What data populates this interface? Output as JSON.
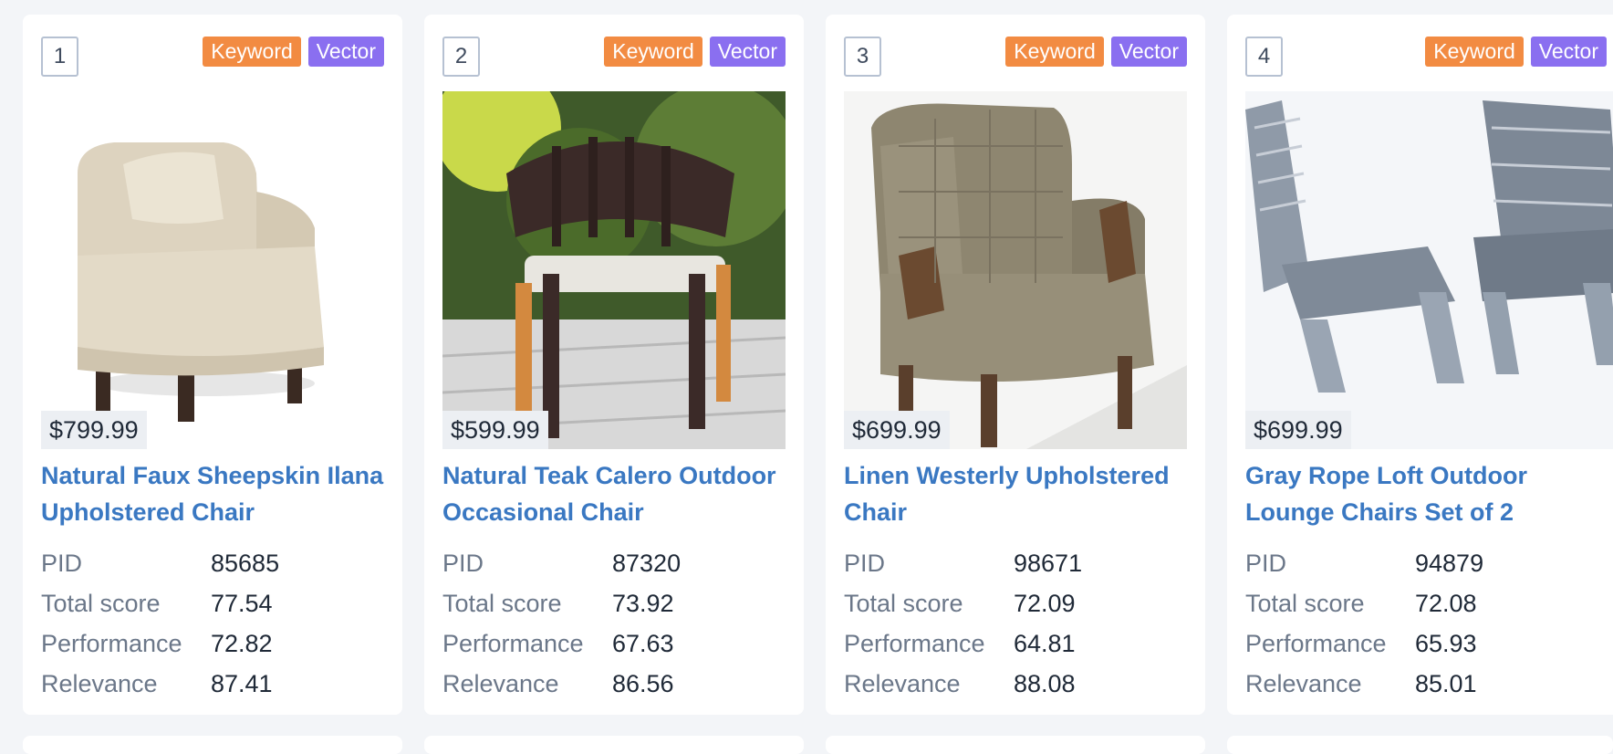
{
  "products": [
    {
      "rank": "1",
      "badges": [
        "Keyword",
        "Vector"
      ],
      "price": "$799.99",
      "title": "Natural Faux Sheepskin Ilana Upholstered Chair",
      "image_icon": "upholstered-armchair-image",
      "stats": [
        {
          "label": "PID",
          "value": "85685"
        },
        {
          "label": "Total score",
          "value": "77.54"
        },
        {
          "label": "Performance",
          "value": "72.82"
        },
        {
          "label": "Relevance",
          "value": "87.41"
        }
      ]
    },
    {
      "rank": "2",
      "badges": [
        "Keyword",
        "Vector"
      ],
      "price": "$599.99",
      "title": "Natural Teak Calero Outdoor Occasional Chair",
      "image_icon": "teak-outdoor-chair-image",
      "stats": [
        {
          "label": "PID",
          "value": "87320"
        },
        {
          "label": "Total score",
          "value": "73.92"
        },
        {
          "label": "Performance",
          "value": "67.63"
        },
        {
          "label": "Relevance",
          "value": "86.56"
        }
      ]
    },
    {
      "rank": "3",
      "badges": [
        "Keyword",
        "Vector"
      ],
      "price": "$699.99",
      "title": "Linen Westerly Upholstered Chair",
      "image_icon": "wingback-chair-image",
      "stats": [
        {
          "label": "PID",
          "value": "98671"
        },
        {
          "label": "Total score",
          "value": "72.09"
        },
        {
          "label": "Performance",
          "value": "64.81"
        },
        {
          "label": "Relevance",
          "value": "88.08"
        }
      ]
    },
    {
      "rank": "4",
      "badges": [
        "Keyword",
        "Vector"
      ],
      "price": "$699.99",
      "title": "Gray Rope Loft Outdoor Lounge Chairs Set of 2",
      "image_icon": "rope-lounge-chairs-image",
      "stats": [
        {
          "label": "PID",
          "value": "94879"
        },
        {
          "label": "Total score",
          "value": "72.08"
        },
        {
          "label": "Performance",
          "value": "65.93"
        },
        {
          "label": "Relevance",
          "value": "85.01"
        }
      ]
    }
  ],
  "colors": {
    "keyword_badge": "#f28b42",
    "vector_badge": "#8a6ff0",
    "title_link": "#3a78c2"
  }
}
